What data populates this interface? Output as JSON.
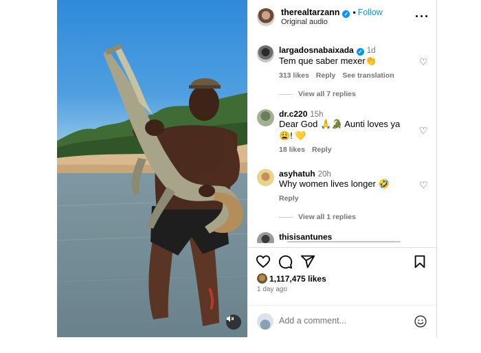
{
  "post": {
    "author": {
      "username": "therealtarzann",
      "verified": true,
      "follow_label": "Follow",
      "separator": "•",
      "audio_label": "Original audio"
    },
    "comments": [
      {
        "username": "largadosnabaixada",
        "verified": true,
        "time": "1d",
        "text": "Tem que saber mexer👏",
        "likes": "313 likes",
        "reply_label": "Reply",
        "translate_label": "See translation",
        "view_replies": "View all 7 replies"
      },
      {
        "username": "dr.c220",
        "verified": false,
        "time": "15h",
        "text": "Dear God 🙏🐊 Aunti loves ya 😩! 💛",
        "likes": "18 likes",
        "reply_label": "Reply"
      },
      {
        "username": "asyhatuh",
        "verified": false,
        "time": "20h",
        "text": "Why women lives longer 🤣",
        "reply_label": "Reply",
        "view_replies": "View all 1 replies"
      },
      {
        "username": "thisisantunes"
      }
    ],
    "likes_count": "1,117,475 likes",
    "time_ago": "1 day ago",
    "add_comment_placeholder": "Add a comment..."
  },
  "icons": {
    "more": "more-horizontal-icon",
    "heart": "heart-icon",
    "comment": "comment-icon",
    "share": "share-icon",
    "save": "bookmark-icon",
    "emoji": "emoji-icon",
    "mute": "muted-speaker-icon",
    "verified": "verified-badge-icon"
  },
  "colors": {
    "accent": "#0095f6",
    "muted_text": "#737373",
    "border": "#dbdbdb"
  }
}
